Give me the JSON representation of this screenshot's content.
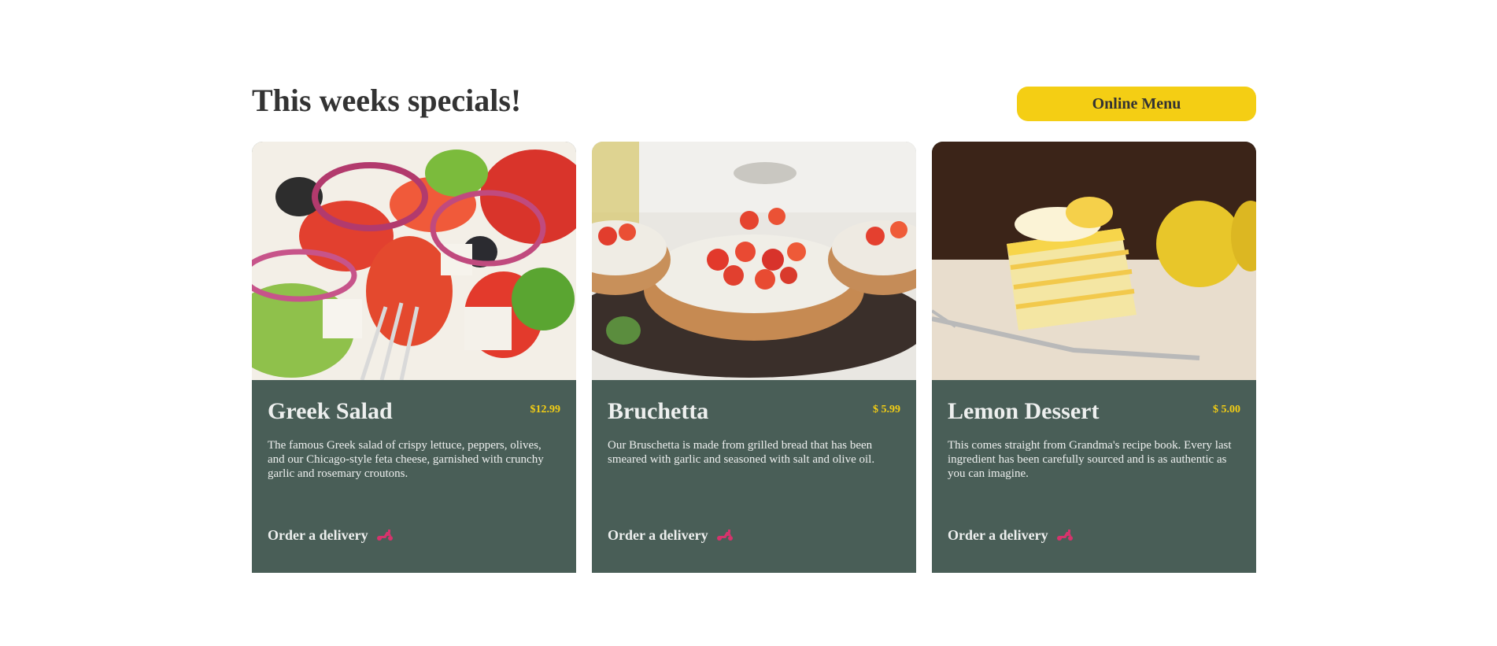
{
  "header": {
    "title": "This weeks specials!",
    "online_menu_label": "Online Menu"
  },
  "colors": {
    "primary_green": "#495e57",
    "primary_yellow": "#f4ce14",
    "highlight_light": "#edefee",
    "heading_dark": "#333333",
    "scooter_pink": "#d6336c"
  },
  "cards": [
    {
      "name": "Greek Salad",
      "price": "$12.99",
      "description": "The famous Greek salad of crispy lettuce, peppers, olives, and our Chicago-style feta cheese, garnished with crunchy garlic and rosemary croutons.",
      "order_label": "Order a delivery",
      "order_icon": "scooter-icon"
    },
    {
      "name": "Bruchetta",
      "price": "$ 5.99",
      "description": "Our Bruschetta is made from grilled bread that has been smeared with garlic and seasoned with salt and olive oil.",
      "order_label": "Order a delivery",
      "order_icon": "scooter-icon"
    },
    {
      "name": "Lemon Dessert",
      "price": "$ 5.00",
      "description": "This comes straight from Grandma's recipe book. Every last ingredient has been carefully sourced and is as authentic as you can imagine.",
      "order_label": "Order a delivery",
      "order_icon": "scooter-icon"
    }
  ]
}
